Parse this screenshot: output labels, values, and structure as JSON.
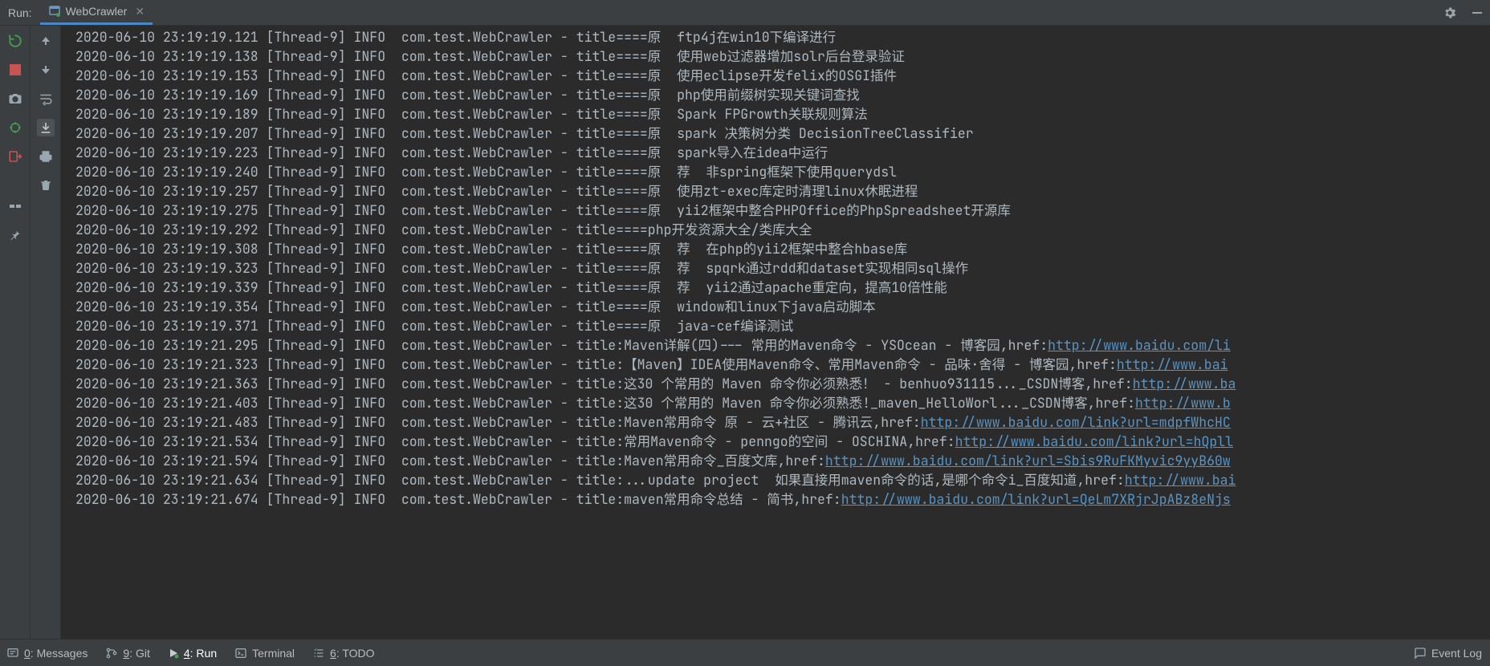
{
  "topbar": {
    "panel_label": "Run:",
    "tab_name": "WebCrawler"
  },
  "gutter_left": [
    {
      "name": "rerun-icon",
      "color": "#499c54",
      "interact": true
    },
    {
      "name": "stop-icon",
      "color": "#c75450",
      "interact": true
    },
    {
      "name": "dump-icon",
      "color": "#9aa7b0",
      "interact": true
    },
    {
      "name": "debug-icon",
      "color": "#499c54",
      "interact": true
    },
    {
      "name": "exit-icon",
      "color": "#c75450",
      "interact": true
    },
    {
      "name": "spacer",
      "color": "",
      "interact": false
    },
    {
      "name": "layout-icon",
      "color": "#9aa7b0",
      "interact": true
    },
    {
      "name": "pin-icon",
      "color": "#9aa7b0",
      "interact": true
    }
  ],
  "gutter_right": [
    {
      "name": "up-icon",
      "color": "#9aa7b0",
      "interact": true
    },
    {
      "name": "down-icon",
      "color": "#9aa7b0",
      "interact": true
    },
    {
      "name": "wrap-icon",
      "color": "#9aa7b0",
      "interact": true
    },
    {
      "name": "scroll-to-end-icon",
      "color": "#9aa7b0",
      "interact": true,
      "selected": true
    },
    {
      "name": "print-icon",
      "color": "#9aa7b0",
      "interact": true
    },
    {
      "name": "trash-icon",
      "color": "#9aa7b0",
      "interact": true
    }
  ],
  "console": {
    "lines": [
      {
        "text": "2020-06-10 23:19:19.121 [Thread-9] INFO  com.test.WebCrawler - title====原  ftp4j在win10下编译进行",
        "link": null
      },
      {
        "text": "2020-06-10 23:19:19.138 [Thread-9] INFO  com.test.WebCrawler - title====原  使用web过滤器增加solr后台登录验证",
        "link": null
      },
      {
        "text": "2020-06-10 23:19:19.153 [Thread-9] INFO  com.test.WebCrawler - title====原  使用eclipse开发felix的OSGI插件",
        "link": null
      },
      {
        "text": "2020-06-10 23:19:19.169 [Thread-9] INFO  com.test.WebCrawler - title====原  php使用前缀树实现关键词查找",
        "link": null
      },
      {
        "text": "2020-06-10 23:19:19.189 [Thread-9] INFO  com.test.WebCrawler - title====原  Spark FPGrowth关联规则算法",
        "link": null
      },
      {
        "text": "2020-06-10 23:19:19.207 [Thread-9] INFO  com.test.WebCrawler - title====原  spark 决策树分类 DecisionTreeClassifier",
        "link": null
      },
      {
        "text": "2020-06-10 23:19:19.223 [Thread-9] INFO  com.test.WebCrawler - title====原  spark导入在idea中运行",
        "link": null
      },
      {
        "text": "2020-06-10 23:19:19.240 [Thread-9] INFO  com.test.WebCrawler - title====原  荐  非spring框架下使用querydsl",
        "link": null
      },
      {
        "text": "2020-06-10 23:19:19.257 [Thread-9] INFO  com.test.WebCrawler - title====原  使用zt-exec库定时清理linux休眠进程",
        "link": null
      },
      {
        "text": "2020-06-10 23:19:19.275 [Thread-9] INFO  com.test.WebCrawler - title====原  yii2框架中整合PHPOffice的PhpSpreadsheet开源库",
        "link": null
      },
      {
        "text": "2020-06-10 23:19:19.292 [Thread-9] INFO  com.test.WebCrawler - title====php开发资源大全/类库大全",
        "link": null
      },
      {
        "text": "2020-06-10 23:19:19.308 [Thread-9] INFO  com.test.WebCrawler - title====原  荐  在php的yii2框架中整合hbase库",
        "link": null
      },
      {
        "text": "2020-06-10 23:19:19.323 [Thread-9] INFO  com.test.WebCrawler - title====原  荐  spqrk通过rdd和dataset实现相同sql操作",
        "link": null
      },
      {
        "text": "2020-06-10 23:19:19.339 [Thread-9] INFO  com.test.WebCrawler - title====原  荐  yii2通过apache重定向，提高10倍性能",
        "link": null
      },
      {
        "text": "2020-06-10 23:19:19.354 [Thread-9] INFO  com.test.WebCrawler - title====原  window和linux下java启动脚本",
        "link": null
      },
      {
        "text": "2020-06-10 23:19:19.371 [Thread-9] INFO  com.test.WebCrawler - title====原  java-cef编译测试",
        "link": null
      },
      {
        "text": "2020-06-10 23:19:21.295 [Thread-9] INFO  com.test.WebCrawler - title:Maven详解(四)--- 常用的Maven命令 - YSOcean - 博客园,href:",
        "link": "http://www.baidu.com/li"
      },
      {
        "text": "2020-06-10 23:19:21.323 [Thread-9] INFO  com.test.WebCrawler - title:【Maven】IDEA使用Maven命令、常用Maven命令 - 品味·舍得 - 博客园,href:",
        "link": "http://www.bai"
      },
      {
        "text": "2020-06-10 23:19:21.363 [Thread-9] INFO  com.test.WebCrawler - title:这30 个常用的 Maven 命令你必须熟悉！ - benhuo931115..._CSDN博客,href:",
        "link": "http://www.ba"
      },
      {
        "text": "2020-06-10 23:19:21.403 [Thread-9] INFO  com.test.WebCrawler - title:这30 个常用的 Maven 命令你必须熟悉!_maven_HelloWorl..._CSDN博客,href:",
        "link": "http://www.b"
      },
      {
        "text": "2020-06-10 23:19:21.483 [Thread-9] INFO  com.test.WebCrawler - title:Maven常用命令 原 - 云+社区 - 腾讯云,href:",
        "link": "http://www.baidu.com/link?url=mdpfWhcHC"
      },
      {
        "text": "2020-06-10 23:19:21.534 [Thread-9] INFO  com.test.WebCrawler - title:常用Maven命令 - penngo的空间 - OSCHINA,href:",
        "link": "http://www.baidu.com/link?url=hQpll"
      },
      {
        "text": "2020-06-10 23:19:21.594 [Thread-9] INFO  com.test.WebCrawler - title:Maven常用命令_百度文库,href:",
        "link": "http://www.baidu.com/link?url=Sbis9RuFKMyvic9yyB60w"
      },
      {
        "text": "2020-06-10 23:19:21.634 [Thread-9] INFO  com.test.WebCrawler - title:...update project  如果直接用maven命令的话,是哪个命令i_百度知道,href:",
        "link": "http://www.bai"
      },
      {
        "text": "2020-06-10 23:19:21.674 [Thread-9] INFO  com.test.WebCrawler - title:maven常用命令总结 - 简书,href:",
        "link": "http://www.baidu.com/link?url=QeLm7XRjrJpABz8eNjs"
      }
    ]
  },
  "bottombar": {
    "items": [
      {
        "icon": "messages-icon",
        "prefix": "0",
        "label": ": Messages"
      },
      {
        "icon": "git-icon",
        "prefix": "9",
        "label": ": Git"
      },
      {
        "icon": "run-icon",
        "prefix": "4",
        "label": ": Run",
        "active": true
      },
      {
        "icon": "terminal-icon",
        "prefix": "",
        "label": "Terminal"
      },
      {
        "icon": "todo-icon",
        "prefix": "6",
        "label": ": TODO"
      }
    ],
    "event_log": "Event Log"
  }
}
